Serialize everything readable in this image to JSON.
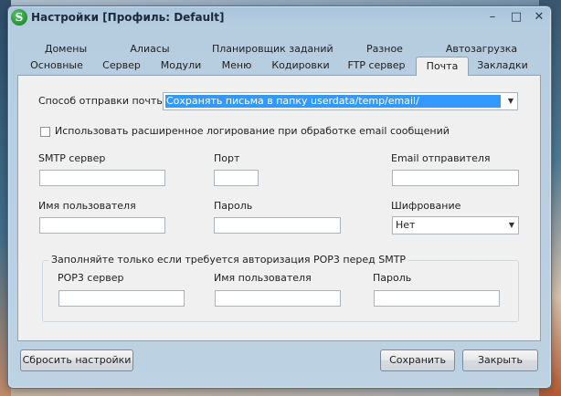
{
  "window": {
    "title": "Настройки [Профиль: Default]",
    "app_icon_letter": "S",
    "controls": {
      "minimize": "–",
      "maximize": "□",
      "close": "✕"
    }
  },
  "tabs": {
    "row1": [
      "Домены",
      "Алиасы",
      "Планировщик заданий",
      "Разное",
      "Автозагрузка"
    ],
    "row2": [
      "Основные",
      "Сервер",
      "Модули",
      "Меню",
      "Кодировки",
      "FTP сервер",
      "Почта",
      "Закладки"
    ],
    "active": "Почта"
  },
  "mail": {
    "send_method_label": "Способ отправки почты:",
    "send_method_value": "Сохранять письма в папку userdata/temp/email/",
    "extended_logging_label": "Использовать расширенное логирование при обработке email сообщений",
    "extended_logging_checked": false,
    "smtp_server_label": "SMTP сервер",
    "smtp_server_value": "",
    "port_label": "Порт",
    "port_value": "",
    "sender_email_label": "Email отправителя",
    "sender_email_value": "",
    "username_label": "Имя пользователя",
    "username_value": "",
    "password_label": "Пароль",
    "password_value": "",
    "encryption_label": "Шифрование",
    "encryption_value": "Нет",
    "pop3_group_title": "Заполняйте только если требуется авторизация POP3 перед SMTP",
    "pop3_server_label": "POP3 сервер",
    "pop3_server_value": "",
    "pop3_username_label": "Имя пользователя",
    "pop3_username_value": "",
    "pop3_password_label": "Пароль",
    "pop3_password_value": ""
  },
  "buttons": {
    "reset": "Сбросить настройки",
    "save": "Сохранить",
    "close": "Закрыть"
  }
}
